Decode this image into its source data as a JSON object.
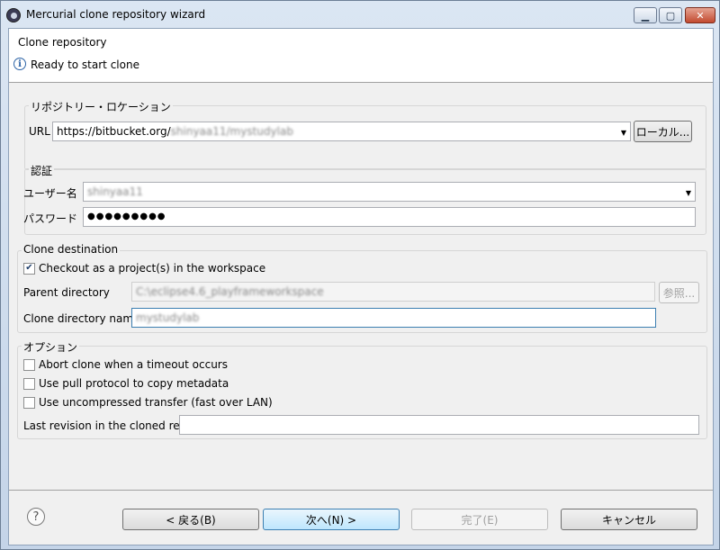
{
  "window": {
    "title": "Mercurial clone repository wizard"
  },
  "header": {
    "title": "Clone repository",
    "status": "Ready to start clone"
  },
  "location": {
    "group_label": "リポジトリー・ロケーション",
    "url_label": "URL",
    "url_prefix": "https://bitbucket.org/",
    "url_blurred": "shinyaa11/mystudylab",
    "local_button": "ローカル..."
  },
  "auth": {
    "group_label": "認証",
    "user_label": "ユーザー名",
    "user_value": "shinyaa11",
    "password_label": "パスワード",
    "password_mask": "●●●●●●●●●"
  },
  "destination": {
    "group_label": "Clone destination",
    "checkout_label": "Checkout as a project(s) in the workspace",
    "checkout_checked": true,
    "parent_label": "Parent directory",
    "parent_value": "C:\\eclipse4.6_playframeworkspace",
    "browse_button": "参照...",
    "clone_dir_label": "Clone directory name",
    "clone_dir_value": "mystudylab"
  },
  "options": {
    "group_label": "オプション",
    "abort_label": "Abort clone when a timeout occurs",
    "pull_label": "Use pull protocol to copy metadata",
    "uncompressed_label": "Use uncompressed transfer (fast over LAN)",
    "last_rev_label": "Last revision in the cloned repo",
    "last_rev_value": ""
  },
  "buttons": {
    "back": "< 戻る(B)",
    "next": "次へ(N) >",
    "finish": "完了(E)",
    "cancel": "キャンセル"
  },
  "icons": {
    "minimize": "minimize-icon",
    "maximize": "maximize-icon",
    "close": "close-icon",
    "info": "info-icon",
    "help": "help-icon"
  },
  "colors": {
    "accent": "#3c7fb1",
    "close": "#c24a2f"
  }
}
